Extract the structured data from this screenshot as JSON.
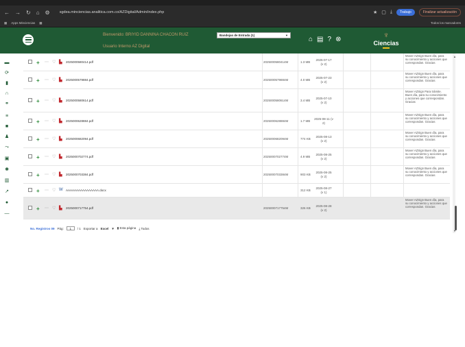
{
  "browser": {
    "url": "sgdea.minciencias.analitica.com.co/AZDigital/Admin/index.php",
    "profile_label": "Trabajo",
    "update_label": "Finalizar actualización",
    "bookmarks": [
      "Apps Minciencias"
    ],
    "all_bookmarks": "Todos los marcadores"
  },
  "header": {
    "welcome": "Bienvenido: BRIYID DANNINA CHACON RUIZ",
    "user_line": "Usuario Interno AZ Digital",
    "tray_select": "Bandejas de Entrada (1)",
    "brand": "Ciencias"
  },
  "rows": [
    {
      "name": "2025000580414.pdf",
      "code": "2025000580414M",
      "size": "1.3 MB",
      "date": "2025-07-17 (v 2)",
      "comment": "Mover AZSign Buen día, para su conocimiento y acciones que correspondan. Gracias",
      "type": "pdf"
    },
    {
      "name": "2025000579884.pdf",
      "code": "2025000579884M",
      "size": "4.0 MB",
      "date": "2025-07-23 (v 2)",
      "comment": "Mover AZSign Buen día, para su conocimiento y acciones que correspondan. Gracias",
      "type": "pdf"
    },
    {
      "name": "2025000580614.pdf",
      "code": "2025000580614M",
      "size": "3.4 MB",
      "date": "2025-07-10 (v 2)",
      "comment": "Mover AZSign Para trámite. Buen día, para su conocimiento y acciones que correspondan. Gracias",
      "type": "pdf"
    },
    {
      "name": "2025000628884.pdf",
      "code": "2025000628884M",
      "size": "1.7 MB",
      "date": "2025-08-11 (v 2)",
      "comment": "Mover AZSign Buen día, para su conocimiento y acciones que correspondan. Gracias",
      "type": "pdf"
    },
    {
      "name": "2025000682094.pdf",
      "code": "2025000682094M",
      "size": "774 KB",
      "date": "2025-08-13 (v 2)",
      "comment": "Mover AZSign Buen día, para su conocimiento y acciones que correspondan. Gracias",
      "type": "pdf"
    },
    {
      "name": "2025000702774.pdf",
      "code": "2025000702774M",
      "size": "4.9 MB",
      "date": "2025-08-25 (v 2)",
      "comment": "Mover AZSign Buen día, para su conocimiento y acciones que correspondan. Gracias",
      "type": "pdf"
    },
    {
      "name": "2025000703384.pdf",
      "code": "2025000703384M",
      "size": "903 KB",
      "date": "2025-08-25 (v 2)",
      "comment": "Mover AZSign Buen día, para su conocimiento y acciones que correspondan. Gracias",
      "type": "pdf"
    },
    {
      "name": "AAAAAAAAAAAAAAAA.docx",
      "code": "",
      "size": "312 KB",
      "date": "2025-08-27 (v 1)",
      "comment": "",
      "type": "doc"
    },
    {
      "name": "2025000717754.pdf",
      "code": "2025000717754M",
      "size": "326 KB",
      "date": "2025-08-28 (v 2)",
      "comment": "Mover AZSign Buen día, para su conocimiento y acciones que correspondan. Gracias",
      "type": "pdf"
    }
  ],
  "footer": {
    "records": "No. Registros 09",
    "page_label": "Pág:",
    "page_value": "1",
    "page_total": "/ 1",
    "export_label": "Exportar a",
    "export_format": "Excel",
    "this_page": "Esta página",
    "all_label": "Todos"
  }
}
